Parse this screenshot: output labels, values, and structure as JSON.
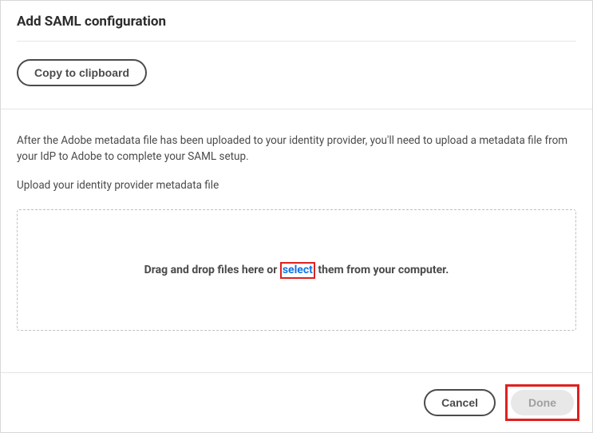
{
  "header": {
    "title": "Add SAML configuration"
  },
  "clipboard": {
    "copy_label": "Copy to clipboard"
  },
  "upload": {
    "instruction": "After the Adobe metadata file has been uploaded to your identity provider, you'll need to upload a metadata file from your IdP to Adobe to complete your SAML setup.",
    "label": "Upload your identity provider metadata file",
    "dropzone_prefix": "Drag and drop files here or ",
    "dropzone_link": "select",
    "dropzone_suffix": " them from your computer."
  },
  "footer": {
    "cancel_label": "Cancel",
    "done_label": "Done"
  }
}
